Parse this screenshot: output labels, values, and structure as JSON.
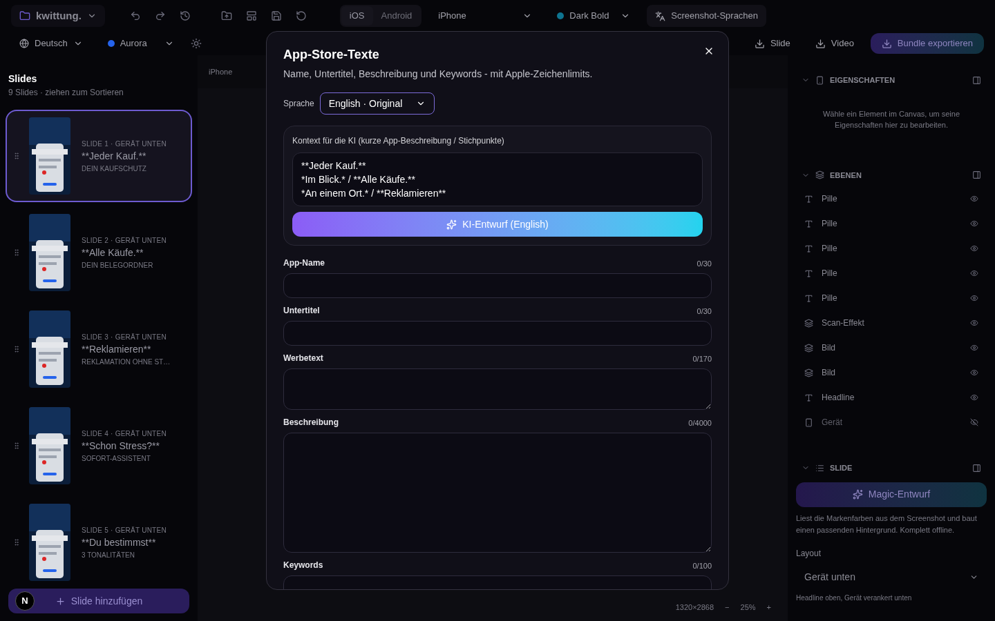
{
  "toolbar": {
    "project": "kwittung.",
    "platforms": [
      {
        "label": "iOS",
        "selected": true
      },
      {
        "label": "Android",
        "selected": false
      }
    ],
    "device": "iPhone",
    "theme": {
      "label": "Dark Bold",
      "color": "#0e7490"
    },
    "languages_button": "Screenshot-Sprachen",
    "language": "Deutsch",
    "palette": {
      "label": "Aurora",
      "color": "#2563eb"
    },
    "exports": [
      "Slide",
      "Video"
    ],
    "bundle_button": "Bundle exportieren"
  },
  "sidebar": {
    "title": "Slides",
    "subtitle": "9 Slides · ziehen zum Sortieren",
    "slides": [
      {
        "meta": "SLIDE 1 · GERÄT UNTEN",
        "title": "**Jeder Kauf.**",
        "caption": "DEIN KAUFSCHUTZ",
        "selected": true
      },
      {
        "meta": "SLIDE 2 · GERÄT UNTEN",
        "title": "**Alle Käufe.**",
        "caption": "DEIN BELEGORDNER",
        "selected": false
      },
      {
        "meta": "SLIDE 3 · GERÄT UNTEN",
        "title": "**Reklamieren**",
        "caption": "REKLAMATION OHNE ST…",
        "selected": false
      },
      {
        "meta": "SLIDE 4 · GERÄT UNTEN",
        "title": "**Schon Stress?**",
        "caption": "SOFORT-ASSISTENT",
        "selected": false
      },
      {
        "meta": "SLIDE 5 · GERÄT UNTEN",
        "title": "**Du bestimmst**",
        "caption": "3 TONALITÄTEN",
        "selected": false
      }
    ],
    "add_button": "Slide hinzufügen",
    "avatar": "N"
  },
  "canvas": {
    "device_label": "iPhone",
    "size": "1320×2868",
    "zoom_out": "−",
    "zoom": "25%",
    "zoom_in": "+"
  },
  "inspector": {
    "properties_title": "EIGENSCHAFTEN",
    "properties_hint": "Wähle ein Element im Canvas, um seine Eigenschaften hier zu bearbeiten.",
    "layers_title": "EBENEN",
    "layers": [
      {
        "label": "Pille",
        "kind": "text",
        "visible": true
      },
      {
        "label": "Pille",
        "kind": "text",
        "visible": true
      },
      {
        "label": "Pille",
        "kind": "text",
        "visible": true
      },
      {
        "label": "Pille",
        "kind": "text",
        "visible": true
      },
      {
        "label": "Pille",
        "kind": "text",
        "visible": true
      },
      {
        "label": "Scan-Effekt",
        "kind": "group",
        "visible": true
      },
      {
        "label": "Bild",
        "kind": "group",
        "visible": true
      },
      {
        "label": "Bild",
        "kind": "group",
        "visible": true
      },
      {
        "label": "Headline",
        "kind": "text",
        "visible": true
      },
      {
        "label": "Gerät",
        "kind": "device",
        "visible": false
      }
    ],
    "slide_title": "SLIDE",
    "magic_button": "Magic-Entwurf",
    "magic_hint": "Liest die Markenfarben aus dem Screenshot und baut einen passenden Hintergrund. Komplett offline.",
    "layout_label": "Layout",
    "layout_value": "Gerät unten",
    "layout_hint": "Headline oben, Gerät verankert unten"
  },
  "dialog": {
    "title": "App-Store-Texte",
    "subtitle": "Name, Untertitel, Beschreibung und Keywords - mit Apple-Zeichenlimits.",
    "language_label": "Sprache",
    "language_value": "English · Original",
    "context_label": "Kontext für die KI (kurze App-Beschreibung / Stichpunkte)",
    "context_value": "**Jeder Kauf.**\n*Im Blick.* / **Alle Käufe.**\n*An einem Ort.* / **Reklamieren**",
    "ai_button": "KI-Entwurf (English)",
    "fields": [
      {
        "label": "App-Name",
        "count": "0/30",
        "kind": "input"
      },
      {
        "label": "Untertitel",
        "count": "0/30",
        "kind": "input"
      },
      {
        "label": "Werbetext",
        "count": "0/170",
        "kind": "short_text"
      },
      {
        "label": "Beschreibung",
        "count": "0/4000",
        "kind": "long_text"
      },
      {
        "label": "Keywords",
        "count": "0/100",
        "kind": "input"
      }
    ]
  }
}
